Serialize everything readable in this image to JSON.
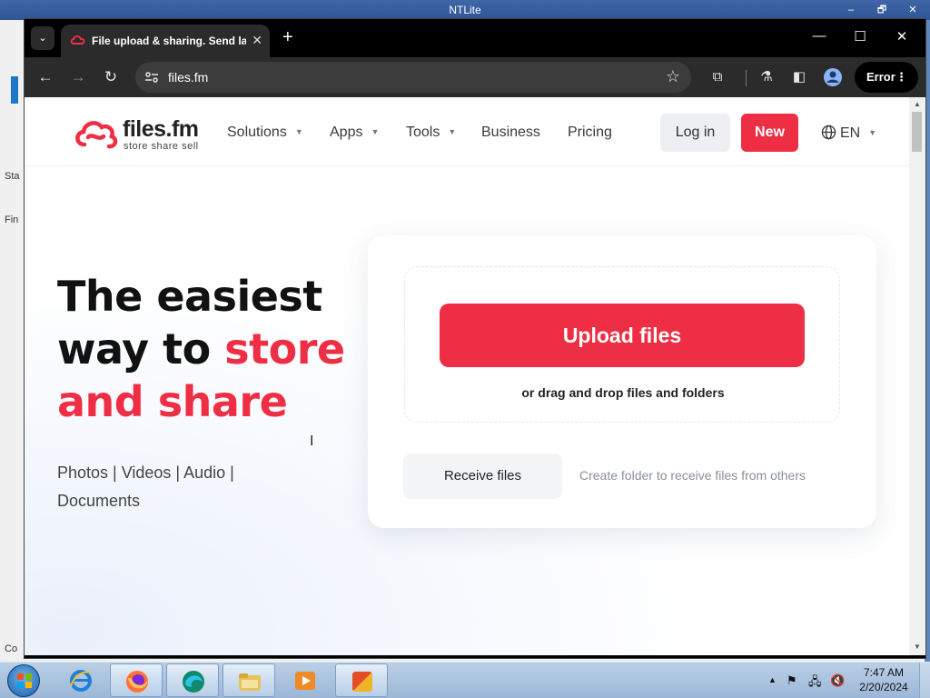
{
  "outer_window": {
    "title": "NTLite",
    "minimize": "–",
    "maximize": "🗗",
    "close": "✕",
    "side_fragments": [
      "Sta",
      "Fin",
      "Co"
    ]
  },
  "browser": {
    "tab": {
      "title": "File upload & sharing. Send large files",
      "close": "✕"
    },
    "new_tab": "+",
    "tab_search": "⌄",
    "window_controls": {
      "minimize": "—",
      "maximize": "☐",
      "close": "✕"
    },
    "toolbar": {
      "back": "←",
      "forward": "→",
      "reload": "↻",
      "url": "files.fm",
      "bookmark": "☆",
      "extensions": "⧉",
      "labs": "⚗",
      "side_panel": "◧",
      "error_label": "Error",
      "menu": "⋮"
    },
    "scroll_arrows": {
      "up": "▲",
      "down": "▼"
    }
  },
  "site": {
    "logo": {
      "name": "files.fm",
      "tagline": "store share sell"
    },
    "nav": [
      {
        "label": "Solutions",
        "caret": "▼"
      },
      {
        "label": "Apps",
        "caret": "▼"
      },
      {
        "label": "Tools",
        "caret": "▼"
      },
      {
        "label": "Business"
      },
      {
        "label": "Pricing"
      }
    ],
    "login": "Log in",
    "new": "New",
    "lang": {
      "label": "EN",
      "caret": "▼"
    },
    "hero": {
      "line1": "The easiest",
      "line2_prefix": "way to ",
      "line2_accent": "store",
      "line3": "and share",
      "media_types": "Photos | Videos | Audio | Documents"
    },
    "upload": {
      "button": "Upload files",
      "drag_text": "or drag and drop files and folders",
      "receive_button": "Receive files",
      "receive_hint": "Create folder to receive files from others"
    },
    "cursor": "I"
  },
  "taskbar": {
    "tray": {
      "arrow": "▲",
      "flag": "⚑",
      "network": "🖧",
      "volume": "🔇"
    },
    "clock": {
      "time": "7:47 AM",
      "date": "2/20/2024"
    }
  },
  "colors": {
    "accent": "#ee2e44",
    "chrome_dark": "#2b2b2b",
    "taskbar": "#9bb7d8"
  }
}
